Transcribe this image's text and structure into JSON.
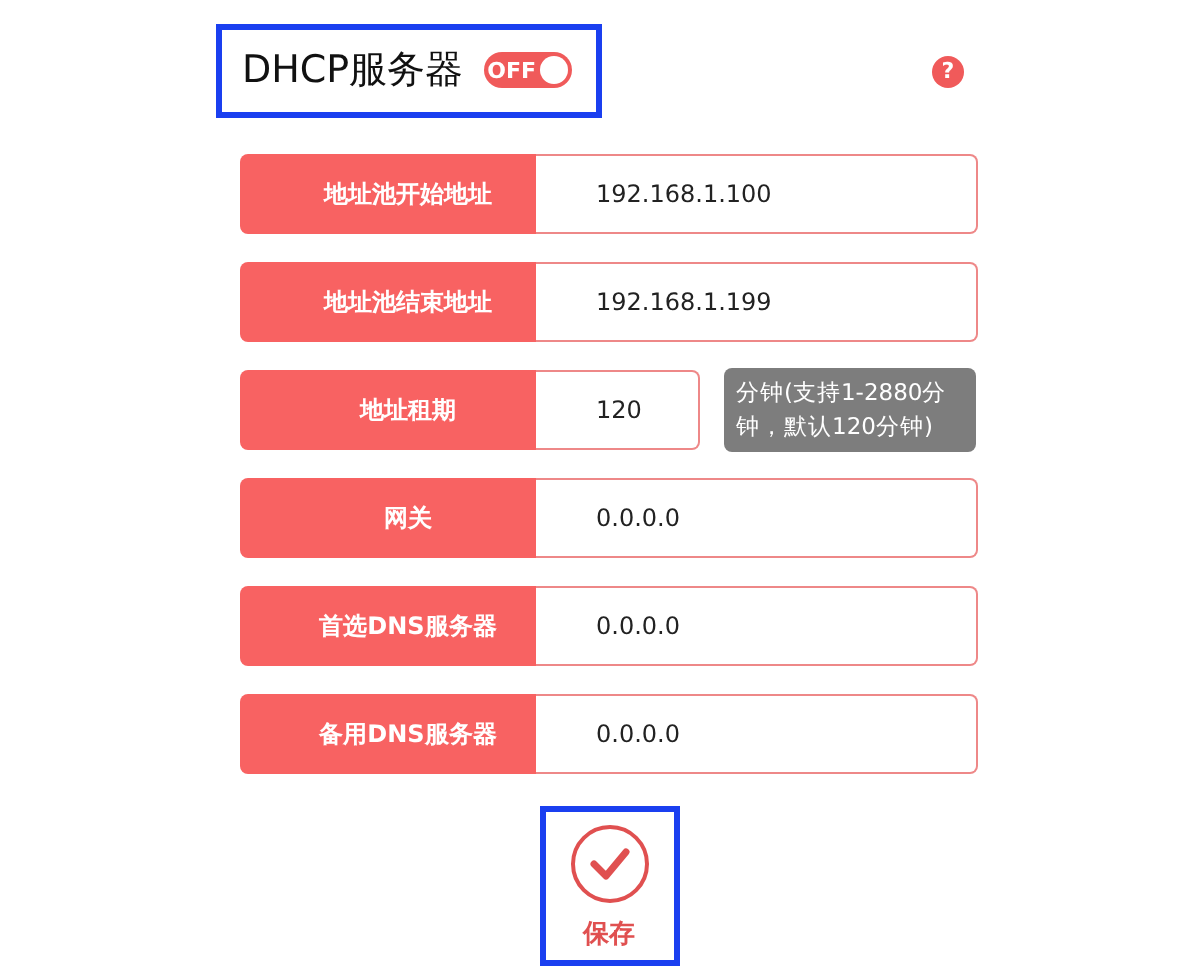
{
  "header": {
    "title": "DHCP服务器",
    "highlighted": true,
    "toggle": {
      "label": "OFF",
      "on": false
    },
    "help": "?"
  },
  "fields": [
    {
      "label": "地址池开始地址",
      "value": "192.168.1.100",
      "kind": "wide"
    },
    {
      "label": "地址池结束地址",
      "value": "192.168.1.199",
      "kind": "wide"
    },
    {
      "label": "地址租期",
      "value": "120",
      "kind": "short",
      "note": "分钟(支持1-2880分钟，默认120分钟)"
    },
    {
      "label": "网关",
      "value": "0.0.0.0",
      "kind": "wide"
    },
    {
      "label": "首选DNS服务器",
      "value": "0.0.0.0",
      "kind": "wide"
    },
    {
      "label": "备用DNS服务器",
      "value": "0.0.0.0",
      "kind": "wide"
    }
  ],
  "save": {
    "label": "保存",
    "highlighted": true
  }
}
